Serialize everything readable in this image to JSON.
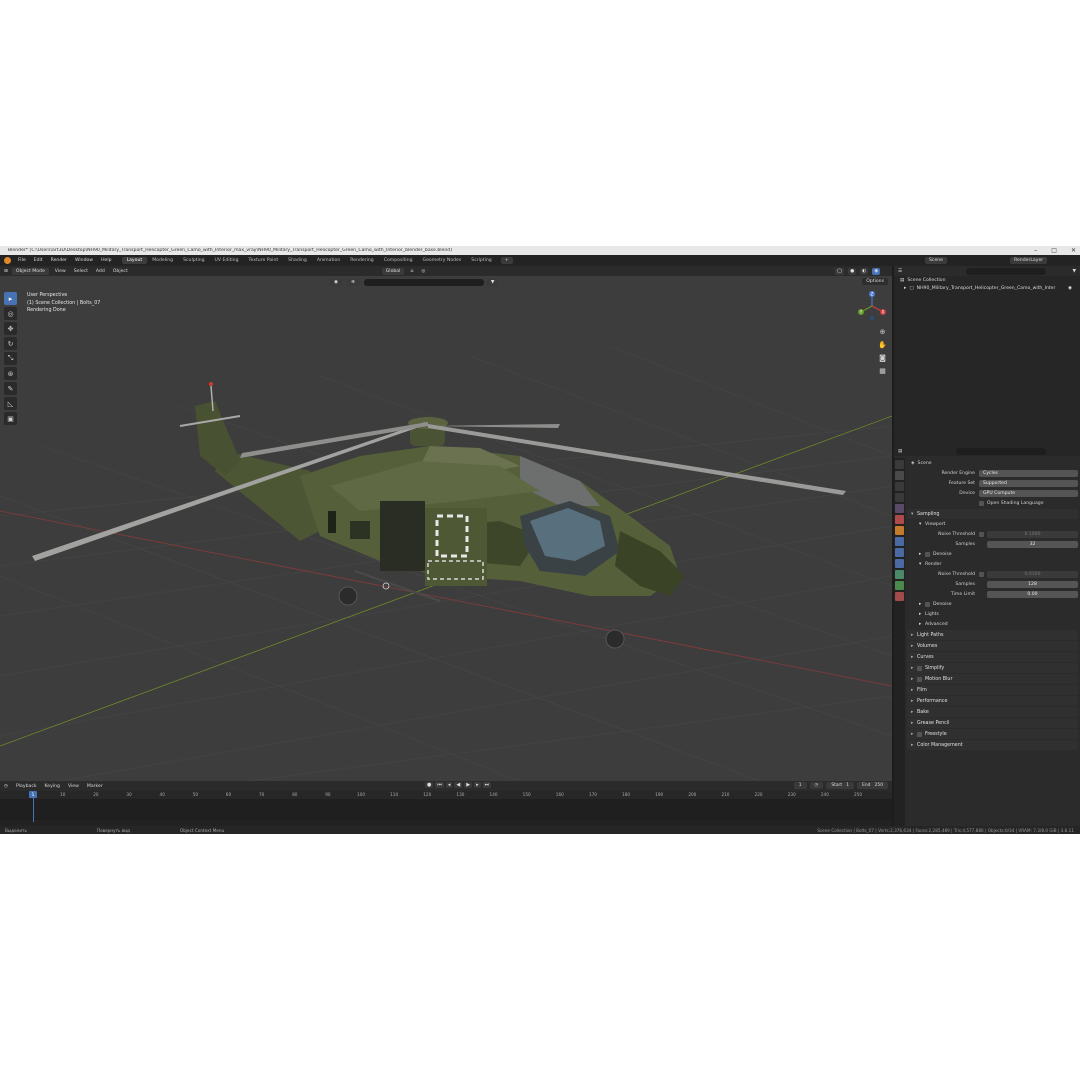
{
  "window": {
    "title": "Blender* [C:\\Users\\art3D\\Desktop\\NH90_Military_Transport_Helicopter_Green_Camo_with_Interior_max_vray\\NH90_Military_Transport_Helicopter_Green_Camo_with_Interior_blender_base.blend]",
    "controls": [
      "–",
      "□",
      "✕"
    ]
  },
  "menu": {
    "items": [
      "File",
      "Edit",
      "Render",
      "Window",
      "Help"
    ],
    "workspaces": [
      "Layout",
      "Modeling",
      "Sculpting",
      "UV Editing",
      "Texture Paint",
      "Shading",
      "Animation",
      "Rendering",
      "Compositing",
      "Geometry Nodes",
      "Scripting"
    ],
    "active_workspace": "Layout",
    "scene_label": "Scene",
    "layer_label": "RenderLayer"
  },
  "viewport_header": {
    "mode": "Object Mode",
    "menus": [
      "View",
      "Select",
      "Add",
      "Object"
    ],
    "transform": "Global",
    "options": "Options"
  },
  "viewport": {
    "overlay_lines": [
      "User Perspective",
      "(1) Scene Collection | Bolts_07",
      "Rendering Done"
    ],
    "gizmo": {
      "x": "X",
      "y": "Y",
      "z": "Z"
    }
  },
  "tools": [
    "select",
    "cursor",
    "move",
    "rotate",
    "scale",
    "transform",
    "annotate",
    "measure",
    "add-cube"
  ],
  "timeline": {
    "menus": [
      "Playback",
      "Keying",
      "View",
      "Marker"
    ],
    "current_frame": "1",
    "start_label": "Start",
    "start": "1",
    "end_label": "End",
    "end": "250",
    "ticks": [
      "1",
      "10",
      "20",
      "30",
      "40",
      "50",
      "60",
      "70",
      "80",
      "90",
      "100",
      "110",
      "120",
      "130",
      "140",
      "150",
      "160",
      "170",
      "180",
      "190",
      "200",
      "210",
      "220",
      "230",
      "240",
      "250"
    ]
  },
  "statusbar": {
    "left": [
      "Выделить",
      "Повернуть вид",
      "Object Context Menu"
    ],
    "right": "Scene Collection | Bolts_07 | Verts:2,376,634 | Faces:2,285,489 | Tris:4,577,886 | Objects:0/34 | VRAM: 7.3/8.0 GiB | 3.6.11"
  },
  "outliner": {
    "root": "Scene Collection",
    "item": "NH90_Military_Transport_Helicopter_Green_Camo_with_Inter"
  },
  "properties": {
    "context": "Scene",
    "render_engine_label": "Render Engine",
    "render_engine": "Cycles",
    "feature_set_label": "Feature Set",
    "feature_set": "Supported",
    "device_label": "Device",
    "device": "GPU Compute",
    "osl_label": "Open Shading Language",
    "sampling": "Sampling",
    "viewport": "Viewport",
    "noise_threshold_label": "Noise Threshold",
    "viewport_noise": "0.1000",
    "samples_label": "Samples",
    "viewport_samples": "32",
    "denoise_label": "Denoise",
    "render": "Render",
    "render_noise": "0.0100",
    "render_samples": "128",
    "time_limit_label": "Time Limit",
    "time_limit": "0.00",
    "lights": "Lights",
    "advanced": "Advanced",
    "panels": [
      "Light Paths",
      "Volumes",
      "Curves",
      "Simplify",
      "Motion Blur",
      "Film",
      "Performance",
      "Bake",
      "Grease Pencil",
      "Freestyle",
      "Color Management"
    ]
  },
  "colors": {
    "accent": "#4772b3",
    "viewport_bg": "#3d3d3d",
    "panel_bg": "#2b2b2b",
    "camo_green": "#4f5a36"
  }
}
